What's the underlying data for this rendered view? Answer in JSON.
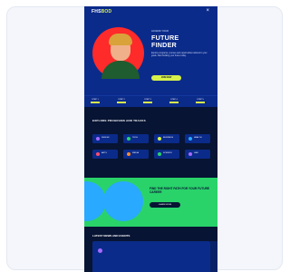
{
  "header": {
    "logo_main": "FHS",
    "logo_accent": "BOD",
    "close_icon": "×"
  },
  "hero": {
    "eyebrow": "ACCESS YOUR",
    "title_line1": "FUTURE",
    "title_line2": "FINDER",
    "subtitle": "Explore programs, courses and opportunities tailored to your goals. Start building your future today.",
    "cta_label": "JOIN NOW"
  },
  "ticker": {
    "items": [
      "STEP 1",
      "STEP 2",
      "STEP 3",
      "STEP 4",
      "STEP 5"
    ]
  },
  "explore": {
    "title": "EXPLORE PROGRAMS AND TRACKS",
    "tiles": [
      {
        "label": "DESIGN",
        "color": "#a56bff"
      },
      {
        "label": "TECH",
        "color": "#29d36a"
      },
      {
        "label": "BUSINESS",
        "color": "#d8f14a"
      },
      {
        "label": "HEALTH",
        "color": "#29a9ff"
      },
      {
        "label": "ARTS",
        "color": "#ff4d6d"
      },
      {
        "label": "MEDIA",
        "color": "#ff8a2a"
      },
      {
        "label": "SCIENCE",
        "color": "#29d36a"
      },
      {
        "label": "LAW",
        "color": "#a56bff"
      }
    ]
  },
  "promo": {
    "title": "FIND THE RIGHT PATH FOR YOUR FUTURE CAREER",
    "cta_label": "LEARN MORE"
  },
  "news": {
    "title": "LATEST NEWS AND EVENTS"
  },
  "colors": {
    "navy": "#071433",
    "blue": "#0b2b8a",
    "lime": "#d8f14a",
    "green": "#29d36a",
    "sky": "#29a9ff",
    "red": "#ff2a2a"
  }
}
